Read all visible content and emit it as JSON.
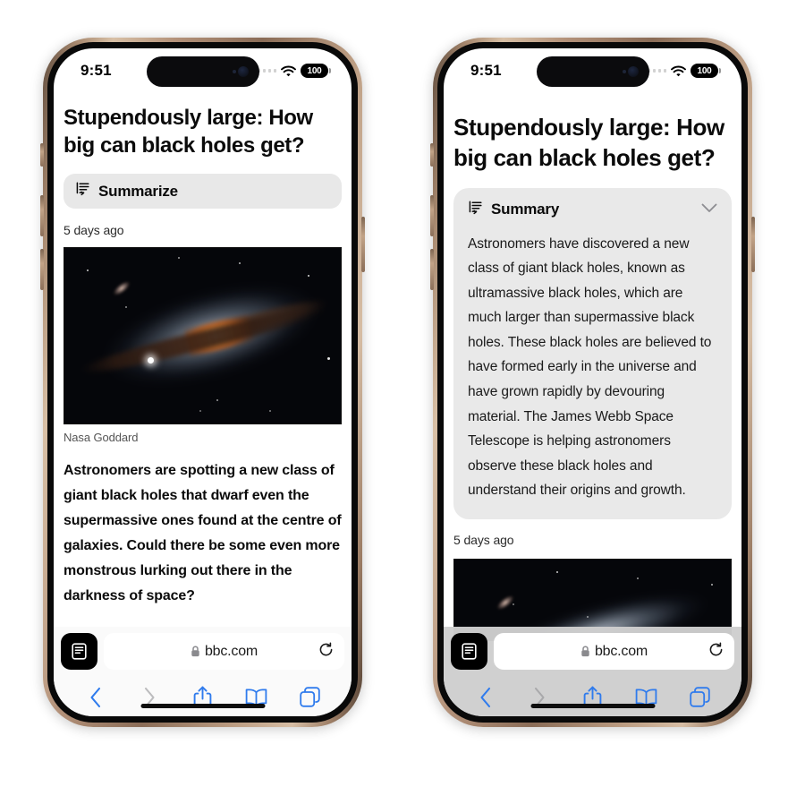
{
  "device": {
    "frame_color": "#b4927a",
    "accent_color": "#2f7bed"
  },
  "phones": [
    {
      "id": "left",
      "label": "iphone-summarize-prompt",
      "status_bar": {
        "time": "9:51",
        "battery": "100",
        "wifi_icon": "wifi-icon",
        "cellular_icon": "cellular-signal-icon",
        "battery_icon": "battery-icon",
        "dynamic_island": "dynamic-island"
      },
      "article": {
        "headline": "Stupendously large: How big can black holes get?",
        "timestamp": "5 days ago",
        "image_caption": "Nasa Goddard",
        "body": "Astronomers are spotting a new class of giant black holes that dwarf even the supermassive ones found at the centre of galaxies. Could there be some even more monstrous lurking out there in the darkness of space?"
      },
      "summarize_button": {
        "label": "Summarize",
        "icon": "summarize-icon"
      },
      "toolbar": {
        "reader_icon": "reader-mode-icon",
        "lock_icon": "lock-icon",
        "url": "bbc.com",
        "reload_icon": "reload-icon",
        "back_icon": "back-chevron-icon",
        "forward_icon": "forward-chevron-icon",
        "share_icon": "share-icon",
        "bookmarks_icon": "bookmarks-book-icon",
        "tabs_icon": "tabs-icon"
      }
    },
    {
      "id": "right",
      "label": "iphone-summary-result",
      "status_bar": {
        "time": "9:51",
        "battery": "100",
        "wifi_icon": "wifi-icon",
        "cellular_icon": "cellular-signal-icon",
        "battery_icon": "battery-icon",
        "dynamic_island": "dynamic-island"
      },
      "article": {
        "headline": "Stupendously large: How big can black holes get?",
        "timestamp": "5 days ago"
      },
      "summary_card": {
        "title": "Summary",
        "icon": "summarize-icon",
        "collapse_icon": "chevron-down-icon",
        "text": "Astronomers have discovered a new class of giant black holes, known as ultramassive black holes, which are much larger than supermassive black holes. These black holes are believed to have formed early in the universe and have grown rapidly by devouring material. The James Webb Space Telescope is helping astronomers observe these black holes and understand their origins and growth."
      },
      "toolbar": {
        "reader_icon": "reader-mode-icon",
        "lock_icon": "lock-icon",
        "url": "bbc.com",
        "reload_icon": "reload-icon",
        "back_icon": "back-chevron-icon",
        "forward_icon": "forward-chevron-icon",
        "share_icon": "share-icon",
        "bookmarks_icon": "bookmarks-book-icon",
        "tabs_icon": "tabs-icon"
      }
    }
  ]
}
